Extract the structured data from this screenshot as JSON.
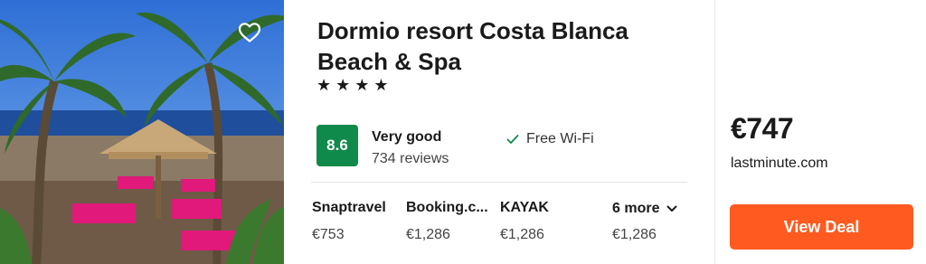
{
  "hotel": {
    "name": "Dormio resort Costa Blanca Beach & Spa",
    "stars_text": "★★★★",
    "star_count": 4
  },
  "rating": {
    "score": "8.6",
    "label": "Very good",
    "reviews": "734 reviews",
    "color": "#0f8a4a"
  },
  "amenities": [
    {
      "icon": "check-icon",
      "label": "Free Wi-Fi"
    }
  ],
  "providers": [
    {
      "name": "Snaptravel",
      "price": "€753"
    },
    {
      "name": "Booking.c...",
      "price": "€1,286"
    },
    {
      "name": "KAYAK",
      "price": "€1,286"
    }
  ],
  "more": {
    "label": "6 more",
    "icon": "chevron-down-icon",
    "price": "€1,286"
  },
  "deal": {
    "price": "€747",
    "site": "lastminute.com",
    "button_label": "View Deal",
    "button_color": "#ff5a1f"
  },
  "photo": {
    "icon": "heart-icon"
  }
}
